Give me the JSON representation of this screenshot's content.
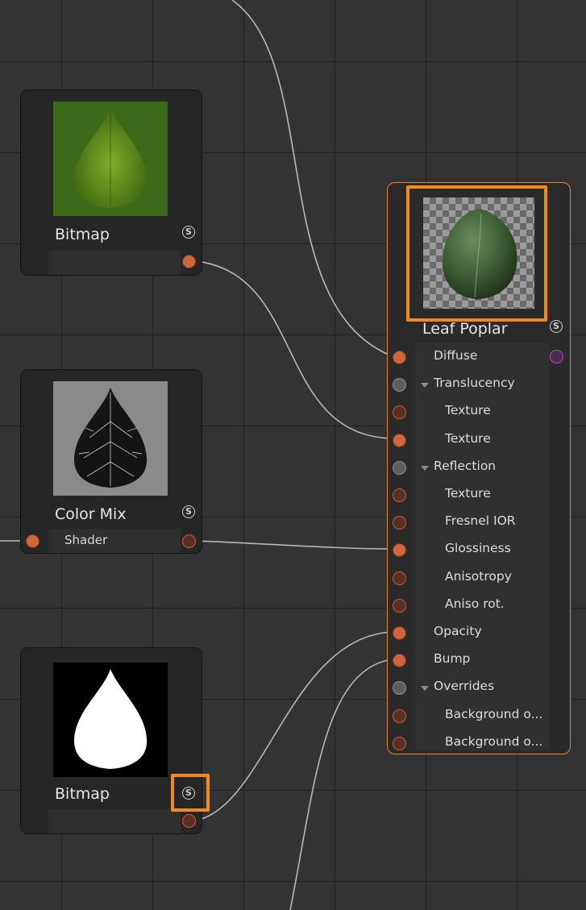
{
  "nodes": {
    "bitmap_top": {
      "title": "Bitmap"
    },
    "color_mix": {
      "title": "Color Mix",
      "input_label": "Shader"
    },
    "bitmap_bottom": {
      "title": "Bitmap"
    }
  },
  "material": {
    "title": "Leaf Poplar",
    "rows": [
      {
        "label": "Diffuse",
        "indent": 0,
        "port": "active",
        "group": false
      },
      {
        "label": "Translucency",
        "indent": 0,
        "port": "gray",
        "group": true
      },
      {
        "label": "Texture",
        "indent": 1,
        "port": "hollow",
        "group": false
      },
      {
        "label": "Texture",
        "indent": 1,
        "port": "active",
        "group": false
      },
      {
        "label": "Reflection",
        "indent": 0,
        "port": "gray",
        "group": true
      },
      {
        "label": "Texture",
        "indent": 1,
        "port": "hollow",
        "group": false
      },
      {
        "label": "Fresnel IOR",
        "indent": 1,
        "port": "hollow",
        "group": false
      },
      {
        "label": "Glossiness",
        "indent": 1,
        "port": "active",
        "group": false
      },
      {
        "label": "Anisotropy",
        "indent": 1,
        "port": "hollow",
        "group": false
      },
      {
        "label": "Aniso rot.",
        "indent": 1,
        "port": "hollow",
        "group": false
      },
      {
        "label": "Opacity",
        "indent": 0,
        "port": "active",
        "group": false
      },
      {
        "label": "Bump",
        "indent": 0,
        "port": "active",
        "group": false
      },
      {
        "label": "Overrides",
        "indent": 0,
        "port": "gray",
        "group": true
      },
      {
        "label": "Background o...",
        "indent": 1,
        "port": "hollow",
        "group": false
      },
      {
        "label": "Background o...",
        "indent": 1,
        "port": "hollow",
        "group": false
      }
    ]
  },
  "shader_icon_glyph": "S",
  "colors": {
    "accent": "#f28a1e",
    "port_active": "#d06640",
    "background": "#333333"
  }
}
